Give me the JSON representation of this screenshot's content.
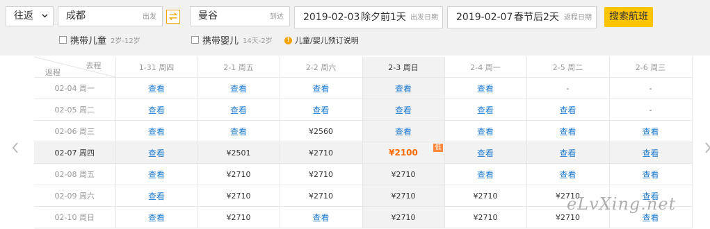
{
  "search": {
    "trip_type": "往返",
    "origin": "成都",
    "origin_label": "出发",
    "destination": "曼谷",
    "destination_label": "到达",
    "depart": {
      "date": "2019-02-03",
      "holiday": "除夕前1天",
      "label": "出发日期"
    },
    "return": {
      "date": "2019-02-07",
      "holiday": "春节后2天",
      "label": "返程日期"
    },
    "search_button": "搜索航班",
    "child_option": {
      "label": "携带儿童",
      "age": "2岁-12岁"
    },
    "infant_option": {
      "label": "携带婴儿",
      "age": "14天-2岁"
    },
    "info_link": "儿童/婴儿预订说明",
    "accent": "#ffc400"
  },
  "grid": {
    "corner_go": "去程",
    "corner_return": "返程",
    "columns": [
      "1-31 周四",
      "2-1 周五",
      "2-2 周六",
      "2-3 周日",
      "2-4 周一",
      "2-5 周二",
      "2-6 周三"
    ],
    "low_tag": "低",
    "rows": [
      {
        "label": "02-04 周一",
        "cells": [
          "查看",
          "查看",
          "查看",
          "查看",
          "查看",
          "-",
          "-"
        ]
      },
      {
        "label": "02-05 周二",
        "cells": [
          "查看",
          "查看",
          "查看",
          "查看",
          "查看",
          "查看",
          "-"
        ]
      },
      {
        "label": "02-06 周三",
        "cells": [
          "查看",
          "查看",
          "¥2560",
          "查看",
          "查看",
          "查看",
          "查看"
        ]
      },
      {
        "label": "02-07 周四",
        "cells": [
          "查看",
          "¥2501",
          "¥2710",
          "¥2100",
          "查看",
          "查看",
          "查看"
        ]
      },
      {
        "label": "02-08 周五",
        "cells": [
          "查看",
          "¥2710",
          "¥2710",
          "¥2710",
          "查看",
          "查看",
          "查看"
        ]
      },
      {
        "label": "02-09 周六",
        "cells": [
          "查看",
          "¥2710",
          "¥2710",
          "¥2710",
          "¥2710",
          "¥2710",
          "查看"
        ]
      },
      {
        "label": "02-10 周日",
        "cells": [
          "查看",
          "¥2710",
          "查看",
          "¥2710",
          "¥2710",
          "¥2710",
          "查看"
        ]
      }
    ]
  },
  "watermark": "eLvXing.net"
}
